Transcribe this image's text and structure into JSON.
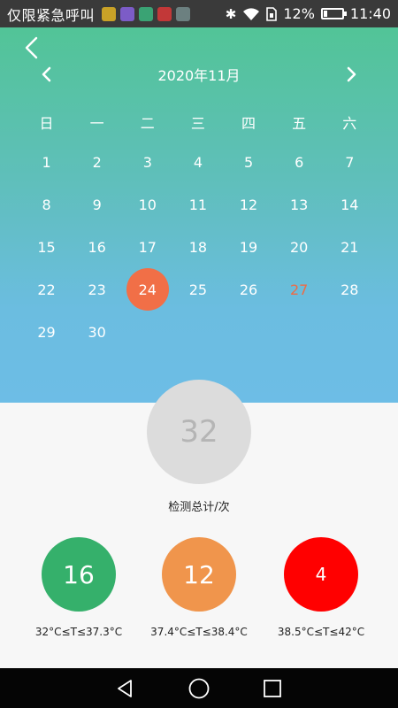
{
  "status_bar": {
    "carrier": "仅限紧急呼叫",
    "battery": "12%",
    "time": "11:40",
    "notification_icons": [
      {
        "name": "app-icon-yellow",
        "color": "#c9a227"
      },
      {
        "name": "app-icon-purple",
        "color": "#7c5cc7"
      },
      {
        "name": "app-icon-green",
        "color": "#3aa374"
      },
      {
        "name": "app-icon-red",
        "color": "#c23838"
      },
      {
        "name": "app-icon-gray",
        "color": "#6c8080"
      }
    ]
  },
  "calendar": {
    "month_title": "2020年11月",
    "weekdays": [
      "日",
      "一",
      "二",
      "三",
      "四",
      "五",
      "六"
    ],
    "leading_blanks": 0,
    "days": [
      "1",
      "2",
      "3",
      "4",
      "5",
      "6",
      "7",
      "8",
      "9",
      "10",
      "11",
      "12",
      "13",
      "14",
      "15",
      "16",
      "17",
      "18",
      "19",
      "20",
      "21",
      "22",
      "23",
      "24",
      "25",
      "26",
      "27",
      "28",
      "29",
      "30"
    ],
    "selected_day": "24",
    "today": "27",
    "colors": {
      "gradient_top": "#52c497",
      "gradient_bottom": "#6dbde6",
      "selected_bg": "#f16f47",
      "today_text": "#ef6b45"
    }
  },
  "summary": {
    "total": "32",
    "total_label": "检测总计/次",
    "stats": [
      {
        "value": "16",
        "range": "32°C≤T≤37.3°C",
        "color": "#35b06b"
      },
      {
        "value": "12",
        "range": "37.4°C≤T≤38.4°C",
        "color": "#f0954c"
      },
      {
        "value": "4",
        "range": "38.5°C≤T≤42°C",
        "color": "#ff0000"
      }
    ]
  },
  "nav": {
    "back_icon": "triangle-back-icon",
    "home_icon": "circle-home-icon",
    "recents_icon": "square-recents-icon"
  }
}
